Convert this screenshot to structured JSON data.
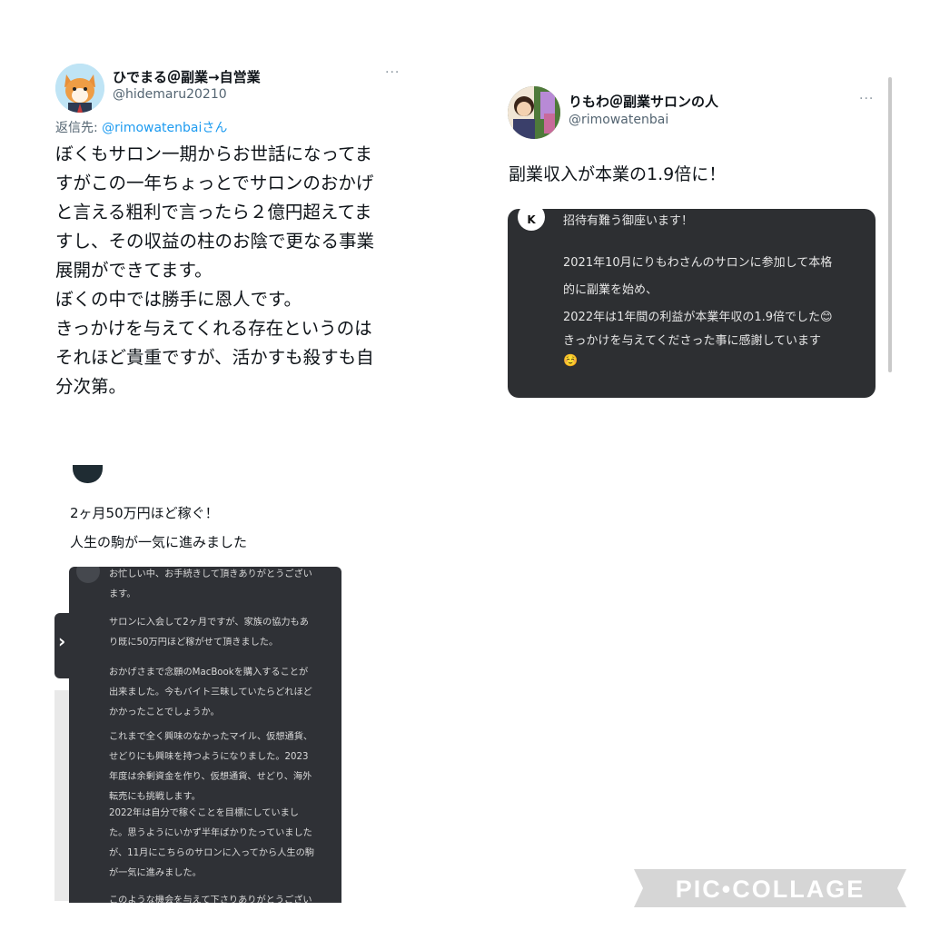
{
  "tweet1": {
    "name": "ひでまる＠副業→自営業",
    "handle": "@hidemaru20210",
    "reply_prefix": "返信先: ",
    "reply_handle": "@rimowatenbai",
    "reply_suffix": "さん",
    "more": "···",
    "body": "ぼくもサロン一期からお世話になってま\nすがこの一年ちょっとでサロンのおかげ\nと言える粗利で言ったら２億円超えてま\nすし、その収益の柱のお陰で更なる事業\n展開ができてます。\nぼくの中では勝手に恩人です。\nきっかけを与えてくれる存在というのは\nそれほど貴重ですが、活かすも殺すも自\n分次第。"
  },
  "tweet2": {
    "name": "りもわ＠副業サロンの人",
    "handle": "@rimowatenbai",
    "more": "···",
    "body": "副業収入が本業の1.9倍に！",
    "card": {
      "icon_letter": "K",
      "line1": "招待有難う御座います！",
      "line2": "2021年10月にりもわさんのサロンに参加して本格",
      "line3": "的に副業を始め、",
      "line4": "2022年は1年間の利益が本業年収の1.9倍でした😊",
      "line5": "きっかけを与えてくださった事に感謝しています",
      "line6": "☺️"
    }
  },
  "tweet3": {
    "body_line1": "2ヶ月50万円ほど稼ぐ！",
    "body_line2": "人生の駒が一気に進みました",
    "chevron": "›",
    "card": {
      "p1": "お忙しい中、お手続きして頂きありがとうござい\nます。",
      "p2": "サロンに入会して2ヶ月ですが、家族の協力もあ\nり既に50万円ほど稼がせて頂きました。",
      "p3": "おかげさまで念願のMacBookを購入することが\n出来ました。今もバイト三昧していたらどれほど\nかかったことでしょうか。",
      "p4": "これまで全く興味のなかったマイル、仮想通貨、\nせどりにも興味を持つようになりました。2023\n年度は余剰資金を作り、仮想通貨、せどり、海外\n転売にも挑戦します。",
      "p5": "2022年は自分で稼ぐことを目標にしていまし\nた。思うようにいかず半年ばかりたっていました\nが、11月にこちらのサロンに入ってから人生の駒\nが一気に進みました。",
      "p6": "このような機会を与えて下さりありがとうござい"
    }
  },
  "watermark": "PIC•COLLAGE"
}
